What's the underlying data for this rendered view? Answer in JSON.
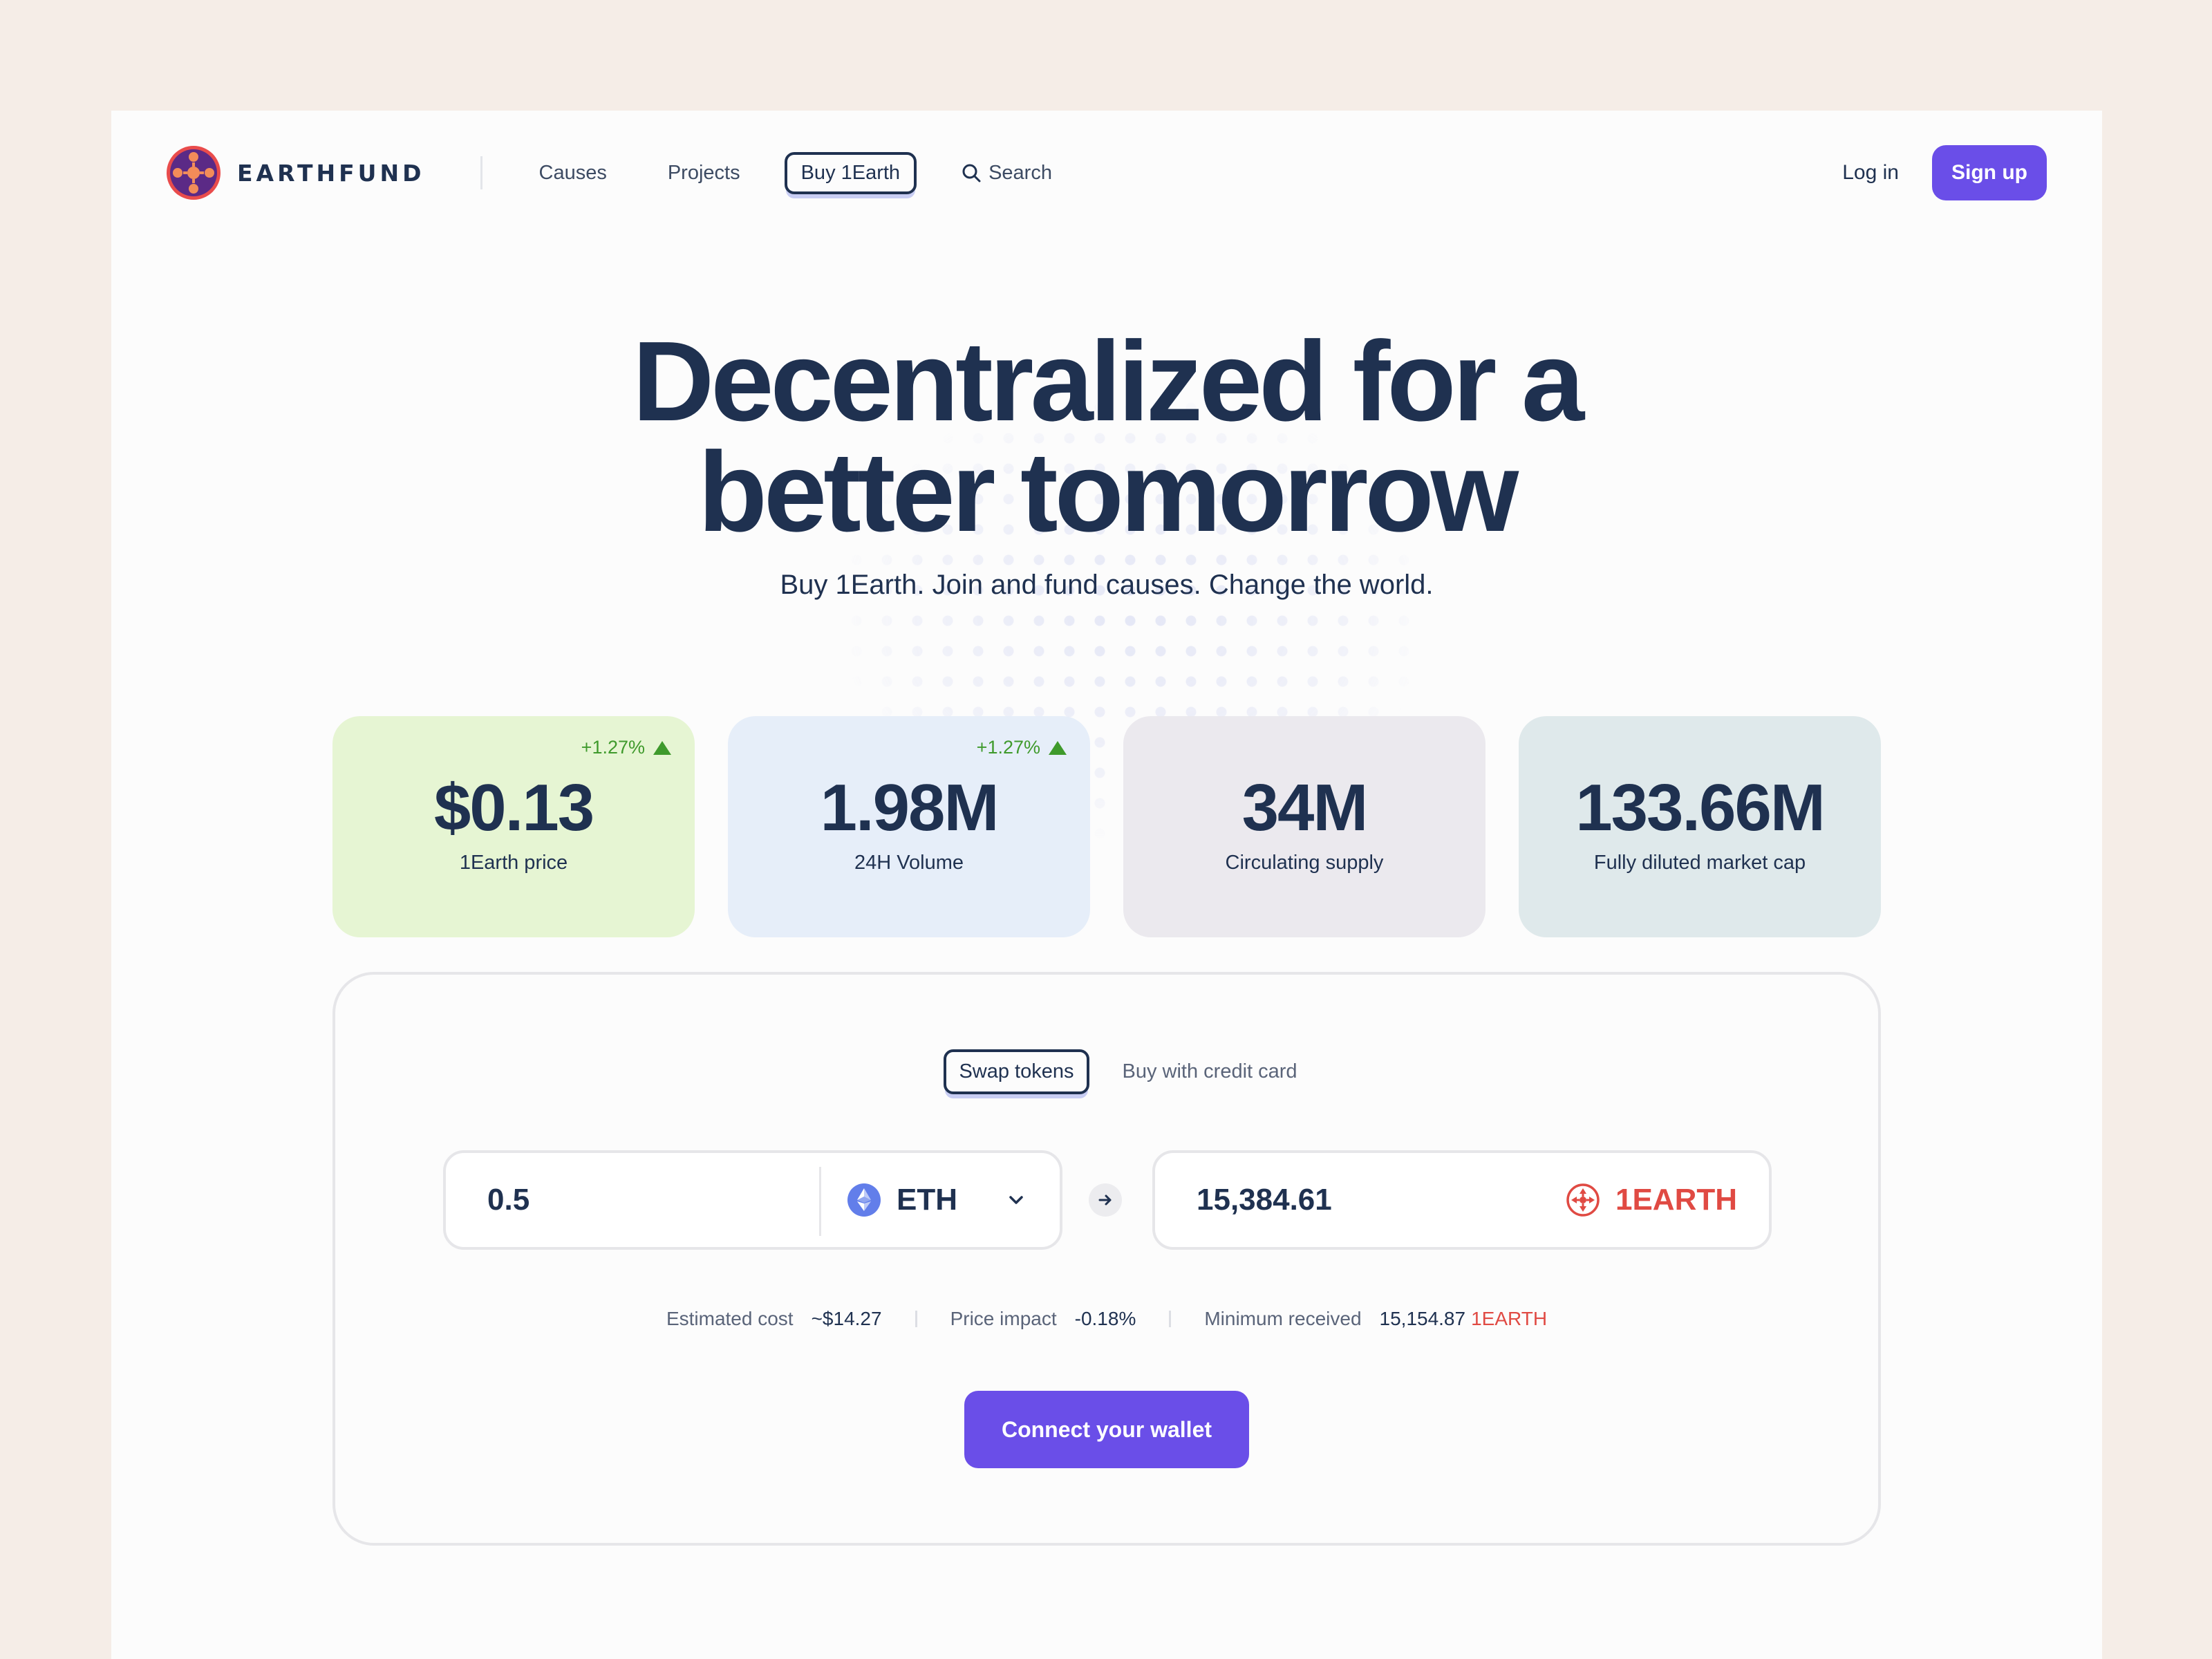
{
  "brand": {
    "name": "EARTHFUND"
  },
  "nav": {
    "links": [
      "Causes",
      "Projects"
    ],
    "active": "Buy 1Earth",
    "search": "Search",
    "login": "Log in",
    "signup": "Sign up"
  },
  "hero": {
    "title_line1": "Decentralized for a",
    "title_line2": "better tomorrow",
    "subtitle": "Buy 1Earth. Join and fund causes. Change the world."
  },
  "stats": [
    {
      "value": "$0.13",
      "label": "1Earth price",
      "change": "+1.27%",
      "bg": "#e6f5d3"
    },
    {
      "value": "1.98M",
      "label": "24H Volume",
      "change": "+1.27%",
      "bg": "#e6eef9"
    },
    {
      "value": "34M",
      "label": "Circulating supply",
      "change": "",
      "bg": "#ebe9ee"
    },
    {
      "value": "133.66M",
      "label": "Fully diluted market cap",
      "change": "",
      "bg": "#dfe9eb"
    }
  ],
  "swap": {
    "tabs": [
      "Swap tokens",
      "Buy with credit card"
    ],
    "from_amount": "0.5",
    "from_token": "ETH",
    "to_amount": "15,384.61",
    "to_token": "1EARTH",
    "details": {
      "estimated_cost_label": "Estimated cost",
      "estimated_cost": "~$14.27",
      "price_impact_label": "Price impact",
      "price_impact": "-0.18%",
      "min_received_label": "Minimum received",
      "min_received": "15,154.87",
      "min_received_token": "1EARTH"
    },
    "connect_label": "Connect your wallet"
  },
  "colors": {
    "accent": "#6a4ee8",
    "text": "#1f3150",
    "positive": "#3f9a2c",
    "earth_red": "#e04a43"
  }
}
